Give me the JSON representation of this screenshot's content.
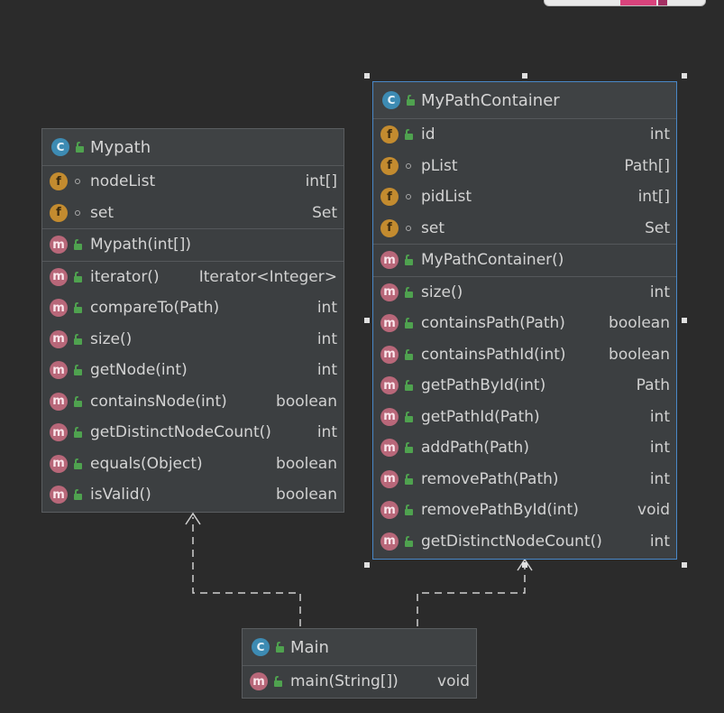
{
  "classes": {
    "mypath": {
      "name": "Mypath",
      "fields": [
        {
          "name": "nodeList",
          "type": "int[]"
        },
        {
          "name": "set",
          "type": "Set"
        }
      ],
      "constructors": [
        {
          "name": "Mypath(int[])",
          "type": ""
        }
      ],
      "methods": [
        {
          "name": "iterator()",
          "type": "Iterator<Integer>"
        },
        {
          "name": "compareTo(Path)",
          "type": "int"
        },
        {
          "name": "size()",
          "type": "int"
        },
        {
          "name": "getNode(int)",
          "type": "int"
        },
        {
          "name": "containsNode(int)",
          "type": "boolean"
        },
        {
          "name": "getDistinctNodeCount()",
          "type": "int"
        },
        {
          "name": "equals(Object)",
          "type": "boolean"
        },
        {
          "name": "isValid()",
          "type": "boolean"
        }
      ]
    },
    "mypathcontainer": {
      "name": "MyPathContainer",
      "fields": [
        {
          "name": "id",
          "type": "int"
        },
        {
          "name": "pList",
          "type": "Path[]"
        },
        {
          "name": "pidList",
          "type": "int[]"
        },
        {
          "name": "set",
          "type": "Set"
        }
      ],
      "constructors": [
        {
          "name": "MyPathContainer()",
          "type": ""
        }
      ],
      "methods": [
        {
          "name": "size()",
          "type": "int"
        },
        {
          "name": "containsPath(Path)",
          "type": "boolean"
        },
        {
          "name": "containsPathId(int)",
          "type": "boolean"
        },
        {
          "name": "getPathById(int)",
          "type": "Path"
        },
        {
          "name": "getPathId(Path)",
          "type": "int"
        },
        {
          "name": "addPath(Path)",
          "type": "int"
        },
        {
          "name": "removePath(Path)",
          "type": "int"
        },
        {
          "name": "removePathById(int)",
          "type": "void"
        },
        {
          "name": "getDistinctNodeCount()",
          "type": "int"
        }
      ]
    },
    "main": {
      "name": "Main",
      "methods": [
        {
          "name": "main(String[])",
          "type": "void"
        }
      ]
    }
  },
  "icons": {
    "class_badge": "C",
    "field_badge": "f",
    "method_badge": "m"
  },
  "colors": {
    "background": "#2b2b2b",
    "node_fill": "#3c3f41",
    "selection_border": "#4a88c7",
    "class_icon": "#3d8bb3",
    "field_icon": "#c38b2f",
    "method_icon": "#b86779",
    "public_lock": "#4fa24f"
  }
}
